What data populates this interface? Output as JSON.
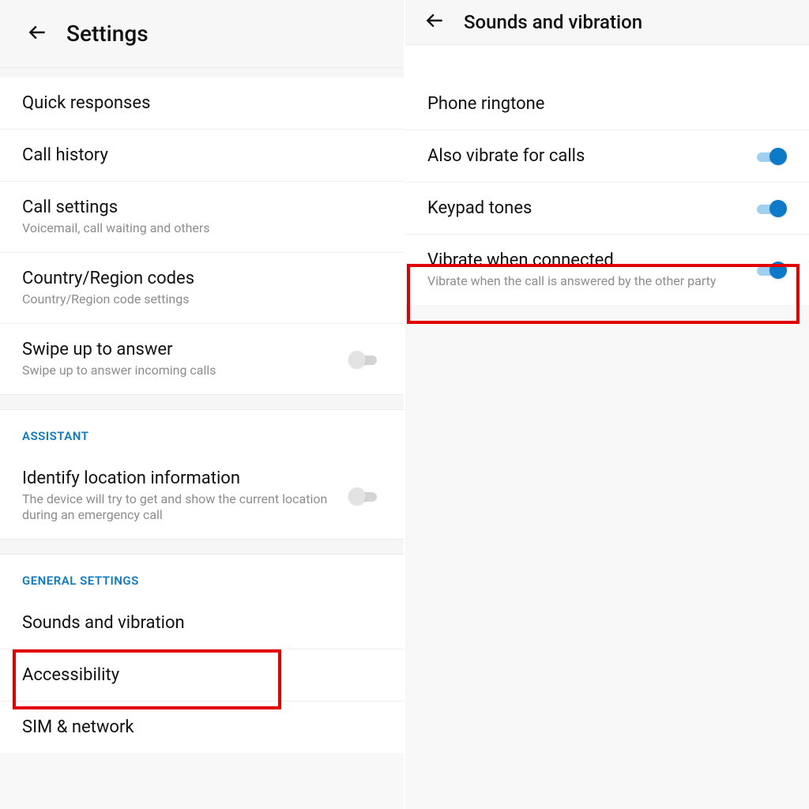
{
  "colors": {
    "accent": "#0d7ac9",
    "highlight": "#e30000"
  },
  "left": {
    "header_title": "Settings",
    "items": {
      "quick_responses": "Quick responses",
      "call_history": "Call history",
      "call_settings": {
        "label": "Call settings",
        "sub": "Voicemail, call waiting and others"
      },
      "country_codes": {
        "label": "Country/Region codes",
        "sub": "Country/Region code settings"
      },
      "swipe_answer": {
        "label": "Swipe up to answer",
        "sub": "Swipe up to answer incoming calls",
        "on": false
      }
    },
    "section_assistant": "Assistant",
    "assistant_item": {
      "label": "Identify location information",
      "sub": "The device will try to get and show the current location during an emergency call",
      "on": false
    },
    "section_general": "General Settings",
    "general_items": {
      "sounds": "Sounds and vibration",
      "accessibility": "Accessibility",
      "sim_network": "SIM & network"
    }
  },
  "right": {
    "header_title": "Sounds and vibration",
    "items": {
      "phone_ringtone": "Phone ringtone",
      "also_vibrate": {
        "label": "Also vibrate for calls",
        "on": true
      },
      "keypad_tones": {
        "label": "Keypad tones",
        "on": true
      },
      "vibrate_connected": {
        "label": "Vibrate when connected",
        "sub": "Vibrate when the call is answered by the other party",
        "on": true
      }
    }
  }
}
